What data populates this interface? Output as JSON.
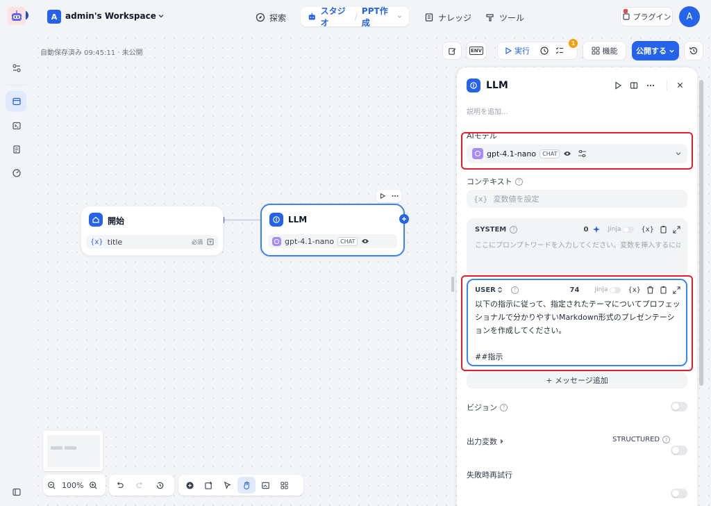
{
  "topbar": {
    "workspace_initial": "A",
    "workspace_name": "admin's Workspace",
    "nav_explore": "探索",
    "nav_studio": "スタジオ",
    "nav_app": "PPT作成",
    "nav_knowledge": "ナレッジ",
    "nav_tools": "ツール",
    "plugin": "プラグイン",
    "user_initial": "A"
  },
  "canvas": {
    "autosave": "自動保存済み 09:45:11 · 未公開",
    "env_label": "ENV",
    "run_label": "実行",
    "checklist_badge": "1",
    "features_label": "機能",
    "publish_label": "公開する"
  },
  "nodes": {
    "start": {
      "title": "開始",
      "var_prefix": "{x}",
      "var_name": "title",
      "var_required": "必須"
    },
    "llm": {
      "title": "LLM",
      "model": "gpt-4.1-nano",
      "model_tag": "CHAT"
    }
  },
  "zoom": {
    "level": "100%"
  },
  "panel": {
    "title": "LLM",
    "description_placeholder": "説明を追加...",
    "ai_model_label": "AIモデル",
    "model_name": "gpt-4.1-nano",
    "model_tag": "CHAT",
    "context_label": "コンテキスト",
    "context_prefix": "{x}",
    "context_placeholder": "変数値を設定",
    "system": {
      "role": "SYSTEM",
      "count": "0",
      "jinja": "Jinja",
      "placeholder": "ここにプロンプトワードを入力してください。変数を挿入するには「{」を..."
    },
    "user": {
      "role": "USER",
      "count": "74",
      "jinja": "Jinja",
      "text": "以下の指示に従って、指定されたテーマについてプロフェッショナルで分かりやすいMarkdown形式のプレゼンテーションを作成してください。\n\n##指示"
    },
    "add_message": "+ メッセージ追加",
    "vision_label": "ビジョン",
    "output_vars_label": "出力変数",
    "structured_label": "STRUCTURED",
    "retry_label": "失敗時再試行"
  }
}
